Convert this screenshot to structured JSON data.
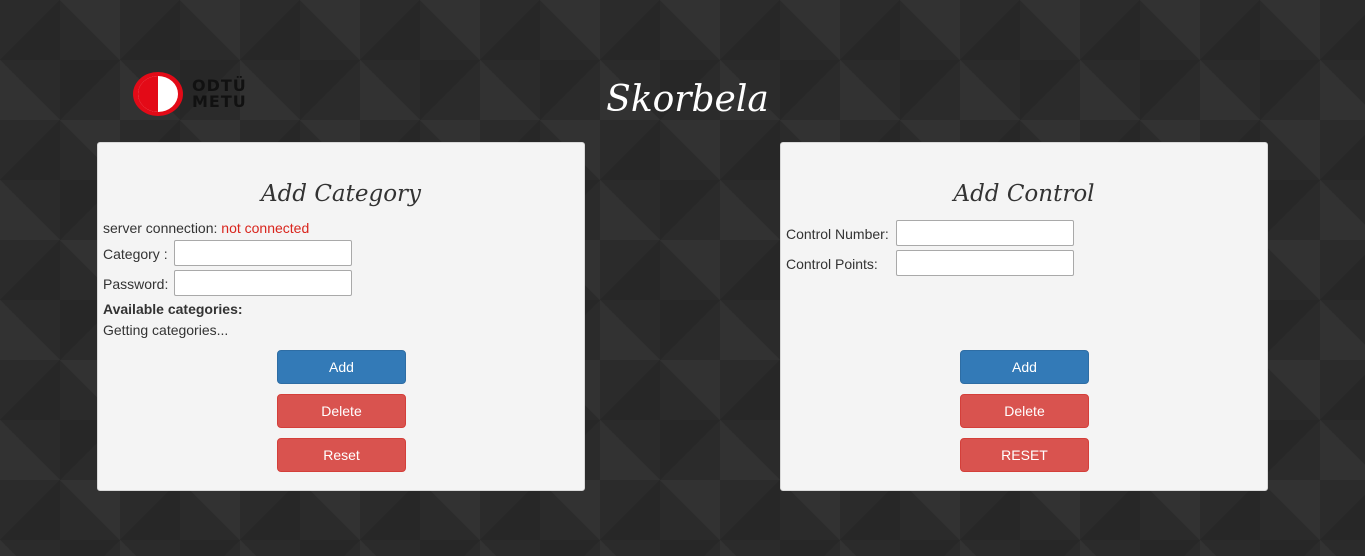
{
  "header": {
    "logo_line1": "ODTÜ",
    "logo_line2": "METU",
    "title": "Skorbela"
  },
  "category_panel": {
    "title": "Add Category",
    "server_connection_label": "server connection:",
    "server_connection_status": "not connected",
    "category_label": "Category :",
    "category_value": "",
    "password_label": "Password:",
    "password_value": "",
    "available_label": "Available categories:",
    "available_status": "Getting categories...",
    "add_label": "Add",
    "delete_label": "Delete",
    "reset_label": "Reset"
  },
  "control_panel": {
    "title": "Add Control",
    "control_number_label": "Control Number:",
    "control_number_value": "",
    "control_points_label": "Control Points:",
    "control_points_value": "",
    "add_label": "Add",
    "delete_label": "Delete",
    "reset_label": "RESET"
  },
  "colors": {
    "background": "#2b2b2b",
    "panel": "#f4f4f4",
    "primary": "#337ab7",
    "danger": "#d9534f",
    "error_text": "#d9251d",
    "logo_red": "#e30a17"
  }
}
